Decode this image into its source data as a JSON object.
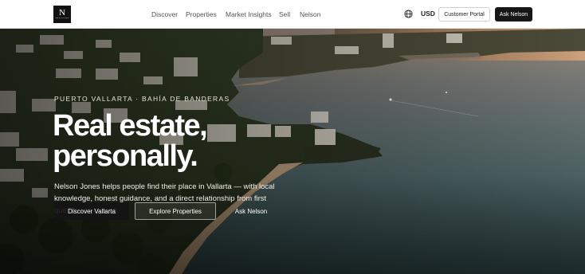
{
  "brand": {
    "logo_mark": "N",
    "logo_sub": "NELSON JONES"
  },
  "nav": {
    "items": [
      {
        "label": "Discover"
      },
      {
        "label": "Properties"
      },
      {
        "label": "Market Insights"
      },
      {
        "label": "Sell"
      },
      {
        "label": "Nelson"
      }
    ]
  },
  "header": {
    "language_icon": "globe-icon",
    "currency": "USD",
    "portal_label": "Customer Portal",
    "ask_label": "Ask Nelson"
  },
  "hero": {
    "eyebrow": "PUERTO VALLARTA · BAHÍA DE BANDERAS",
    "headline_line1": "Real estate,",
    "headline_line2": "personally.",
    "subcopy": "Nelson Jones helps people find their place in Vallarta — with local knowledge, honest guidance, and a direct relationship from first question to closing.",
    "cta_primary": "Discover Vallarta",
    "cta_secondary": "Explore Properties",
    "cta_tertiary": "Ask Nelson"
  },
  "colors": {
    "header_bg": "#ffffff",
    "primary_button": "#161616",
    "sea": "#3c5a5e",
    "sunset": "#d9a77c"
  }
}
